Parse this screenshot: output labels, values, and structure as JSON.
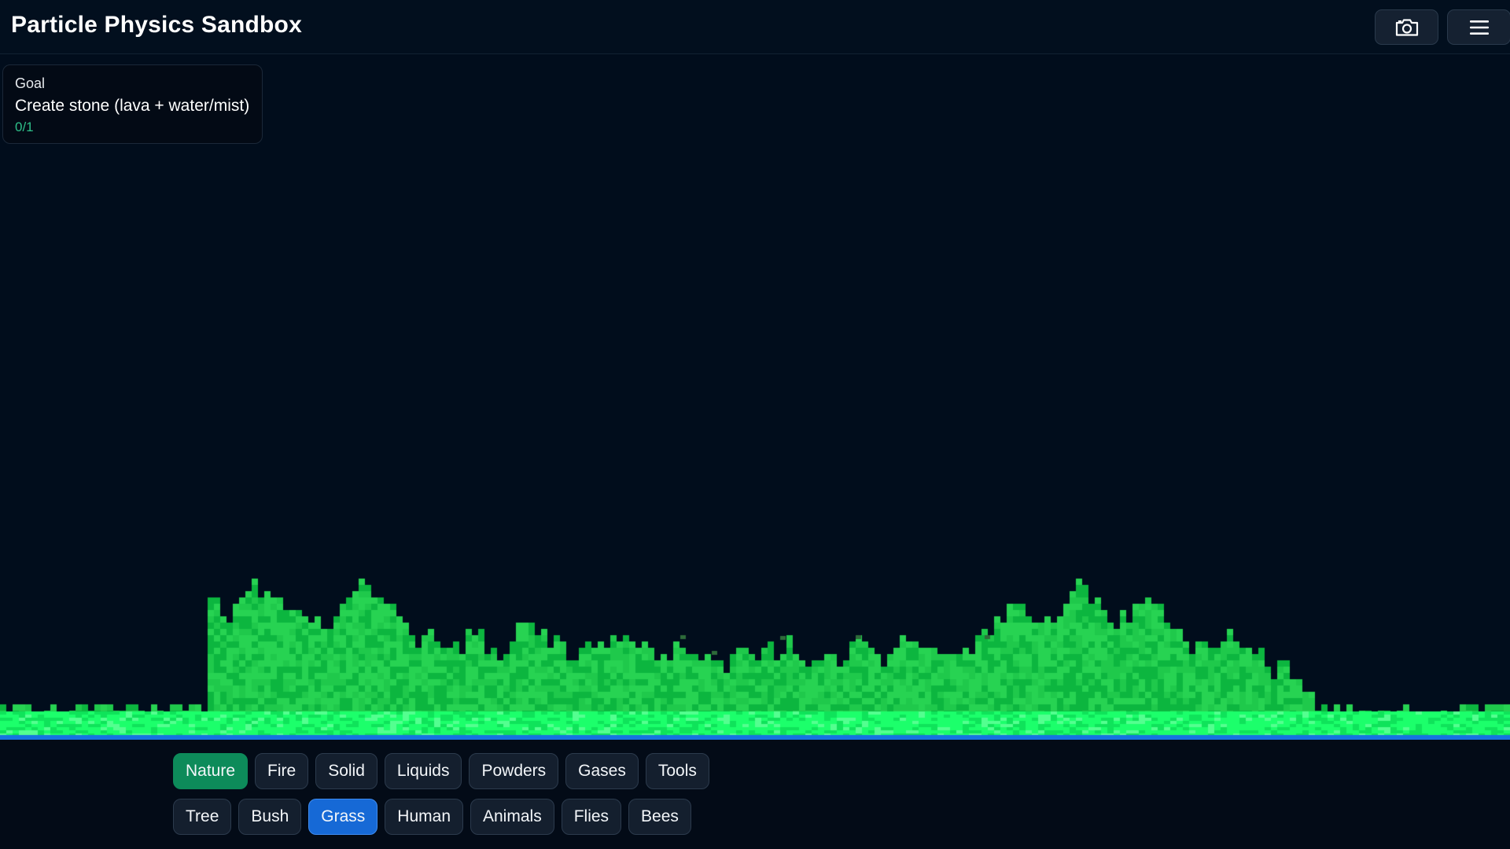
{
  "header": {
    "title": "Particle Physics Sandbox",
    "camera_icon": "camera-icon",
    "menu_icon": "hamburger-menu-icon"
  },
  "goal": {
    "heading": "Goal",
    "text": "Create stone (lava + water/mist)",
    "progress": "0/1"
  },
  "colors": {
    "background": "#010d1c",
    "goal_progress": "#2ec08a",
    "active_category": "#0d8b5a",
    "active_element": "#1669d6",
    "grass_light": "#27d352",
    "grass_dark": "#0cb63f",
    "ground_bright": "#1cff6b",
    "water": "#1774e0"
  },
  "categories": [
    {
      "label": "Nature",
      "active": true
    },
    {
      "label": "Fire",
      "active": false
    },
    {
      "label": "Solid",
      "active": false
    },
    {
      "label": "Liquids",
      "active": false
    },
    {
      "label": "Powders",
      "active": false
    },
    {
      "label": "Gases",
      "active": false
    },
    {
      "label": "Tools",
      "active": false
    }
  ],
  "elements": [
    {
      "label": "Tree",
      "active": false
    },
    {
      "label": "Bush",
      "active": false
    },
    {
      "label": "Grass",
      "active": true
    },
    {
      "label": "Human",
      "active": false
    },
    {
      "label": "Animals",
      "active": false
    },
    {
      "label": "Flies",
      "active": false
    },
    {
      "label": "Bees",
      "active": false
    }
  ]
}
